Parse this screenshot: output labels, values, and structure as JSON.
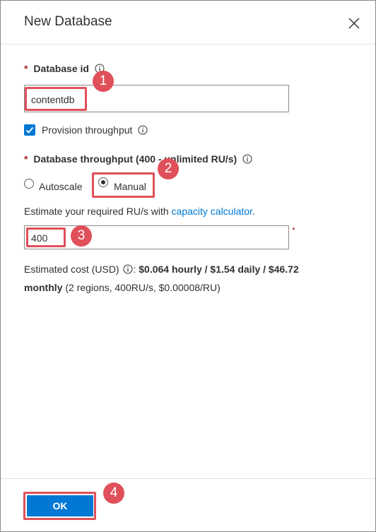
{
  "dialog": {
    "title": "New Database",
    "close_icon": "close-icon"
  },
  "database_id": {
    "required_mark": "*",
    "label": "Database id",
    "value": "contentdb"
  },
  "provision": {
    "checked": true,
    "label": "Provision throughput"
  },
  "throughput": {
    "required_mark": "*",
    "label": "Database throughput (400 - unlimited RU/s)",
    "options": [
      {
        "label": "Autoscale",
        "selected": false
      },
      {
        "label": "Manual",
        "selected": true
      }
    ],
    "estimate_prefix": "Estimate your required RU/s with ",
    "estimate_link": "capacity calculator",
    "estimate_suffix": ".",
    "value": "400",
    "value_required_mark": "*"
  },
  "cost": {
    "prefix": "Estimated cost (USD)",
    "colon": ":",
    "bold_line1": "$0.064 hourly / $1.54 daily / $46.72",
    "bold_line2": "monthly",
    "details": "(2 regions, 400RU/s, $0.00008/RU)"
  },
  "annotations": {
    "badge1": "1",
    "badge2": "2",
    "badge3": "3",
    "badge4": "4"
  },
  "footer": {
    "ok_label": "OK"
  },
  "colors": {
    "accent": "#0078d4",
    "annotation": "#e0505a",
    "required": "#a4262c"
  }
}
